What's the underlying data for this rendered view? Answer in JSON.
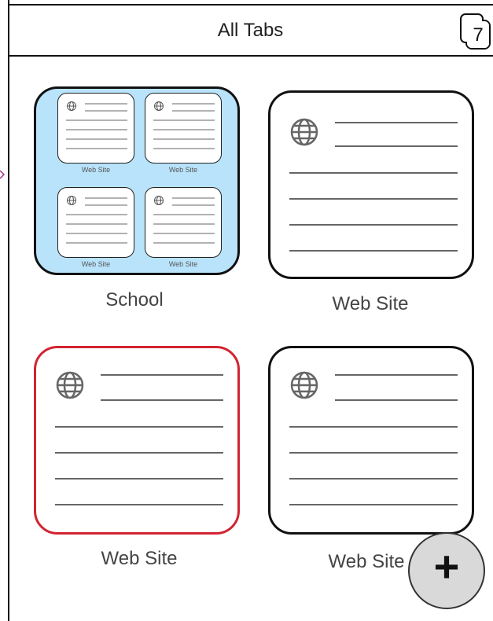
{
  "header": {
    "title": "All Tabs",
    "tab_count": "7"
  },
  "group_card": {
    "label": "School",
    "mini_tabs": [
      {
        "label": "Web Site"
      },
      {
        "label": "Web Site"
      },
      {
        "label": "Web Site"
      },
      {
        "label": "Web Site"
      }
    ]
  },
  "tabs": [
    {
      "label": "Web Site"
    },
    {
      "label": "Web Site"
    },
    {
      "label": "Web Site"
    }
  ],
  "fab": {
    "icon": "plus-icon",
    "symbol": "+"
  },
  "colors": {
    "group_fill": "#b8e3fa",
    "selected_border": "#d22430",
    "fab_fill": "#d9d9d9"
  }
}
